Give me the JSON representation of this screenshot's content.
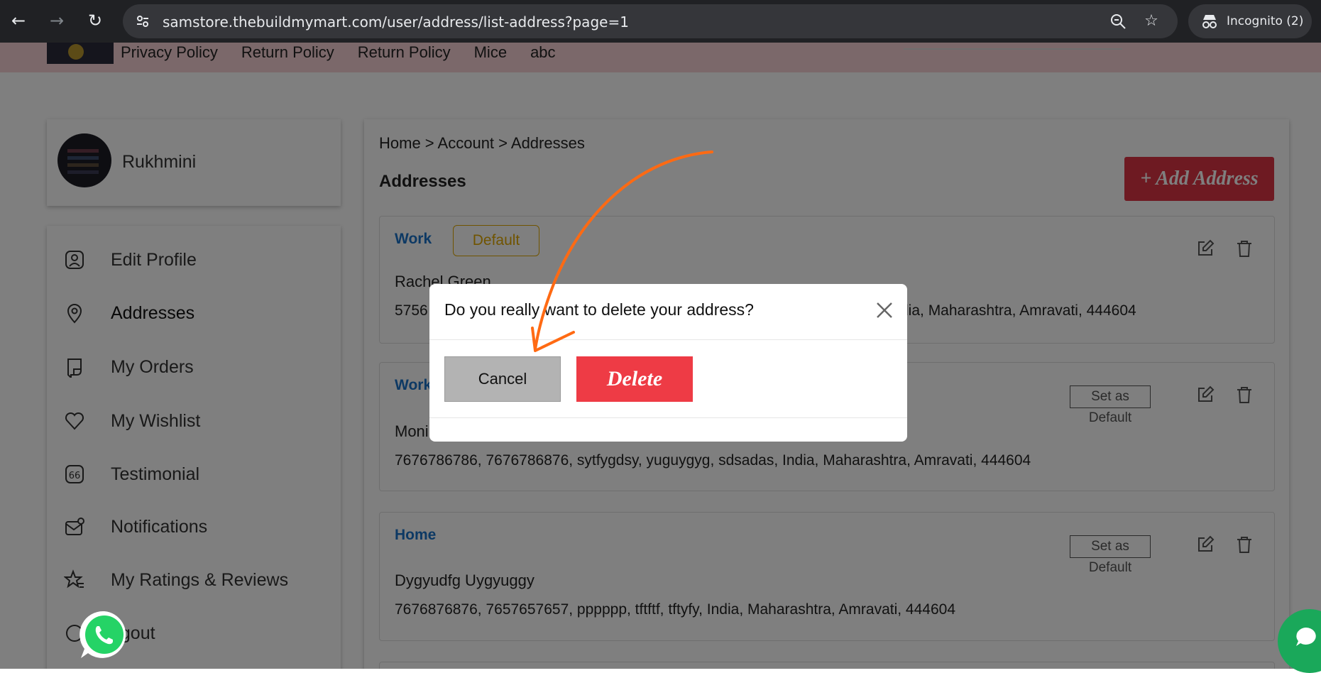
{
  "browser": {
    "url": "samstore.thebuildmymart.com/user/address/list-address?page=1",
    "incognito_label": "Incognito (2)"
  },
  "topnav": {
    "links": [
      "Privacy Policy",
      "Return Policy",
      "Return Policy",
      "Mice",
      "abc"
    ]
  },
  "profile": {
    "name": "Rukhmini"
  },
  "sidebar": {
    "items": [
      {
        "label": "Edit Profile",
        "icon": "user-icon"
      },
      {
        "label": "Addresses",
        "icon": "location-pin-icon"
      },
      {
        "label": "My Orders",
        "icon": "receipt-icon"
      },
      {
        "label": "My Wishlist",
        "icon": "heart-icon"
      },
      {
        "label": "Testimonial",
        "icon": "quote-icon"
      },
      {
        "label": "Notifications",
        "icon": "mail-notification-icon"
      },
      {
        "label": "My Ratings & Reviews",
        "icon": "star-rating-icon"
      },
      {
        "label": "ogout",
        "icon": "logout-icon"
      }
    ]
  },
  "main": {
    "breadcrumb": "Home > Account > Addresses",
    "title": "Addresses",
    "add_button": "+ Add Address",
    "addresses": [
      {
        "type": "Work",
        "badge": "Default",
        "name": "Rachel Green",
        "line_prefix": "5756",
        "line_suffix": "dia, Maharashtra, Amravati, 444604"
      },
      {
        "type": "Work",
        "action": "Set as Default",
        "name": "Moni",
        "line": "7676786786, 7676786876, sytfygdsy, yuguygyg, sdsadas, India, Maharashtra, Amravati, 444604"
      },
      {
        "type": "Home",
        "action": "Set as Default",
        "name": "Dygyudfg Uygyuggy",
        "line": "7676876876, 7657657657, pppppp, tftftf, tftyfy, India, Maharashtra, Amravati, 444604"
      }
    ]
  },
  "modal": {
    "title": "Do you really want to delete your address?",
    "cancel": "Cancel",
    "delete": "Delete"
  },
  "colors": {
    "accent_red": "#dc3545",
    "link_blue": "#1a73c8",
    "default_yellow": "#e0a800",
    "annotation_arrow": "#ff6a13",
    "whatsapp_green": "#25d366"
  }
}
